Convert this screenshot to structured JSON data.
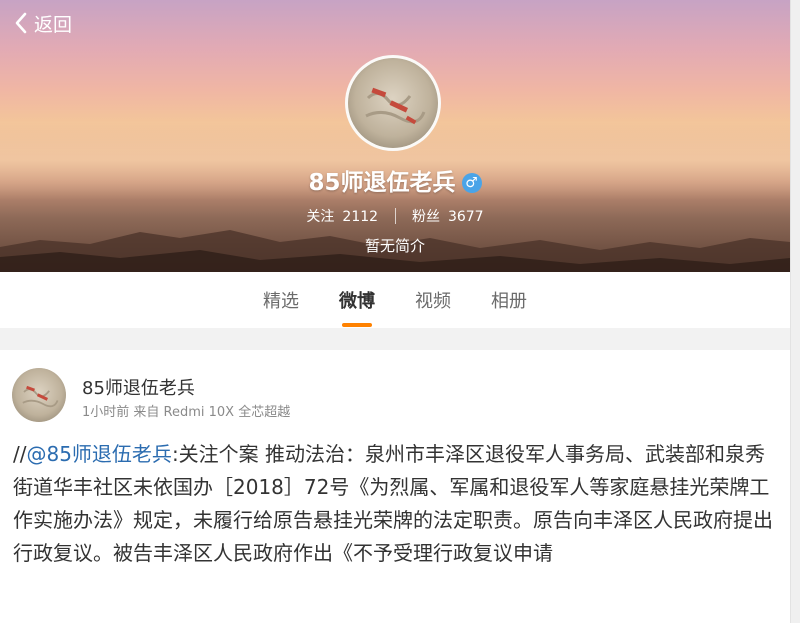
{
  "header": {
    "back_label": "返回",
    "profile_name": "85师退伍老兵",
    "gender_symbol": "♂",
    "following_label": "关注",
    "following_count": "2112",
    "followers_label": "粉丝",
    "followers_count": "3677",
    "bio": "暂无简介"
  },
  "tabs": [
    {
      "label": "精选",
      "active": false
    },
    {
      "label": "微博",
      "active": true
    },
    {
      "label": "视频",
      "active": false
    },
    {
      "label": "相册",
      "active": false
    }
  ],
  "post": {
    "author": "85师退伍老兵",
    "meta": "1小时前 来自 Redmi 10X 全芯超越",
    "prefix": "//",
    "mention": "@85师退伍老兵",
    "text": ":关注个案 推动法治：泉州市丰泽区退役军人事务局、武装部和泉秀街道华丰社区未依国办［2018］72号《为烈属、军属和退役军人等家庭悬挂光荣牌工作实施办法》规定，未履行给原告悬挂光荣牌的法定职责。原告向丰泽区人民政府提出行政复议。被告丰泽区人民政府作出《不予受理行政复议申请"
  },
  "colors": {
    "accent": "#ff8200",
    "mention": "#2b6cb0",
    "gender_badge": "#4aa4e8"
  },
  "icons": {
    "back": "chevron-left-icon",
    "gender": "male-icon"
  }
}
